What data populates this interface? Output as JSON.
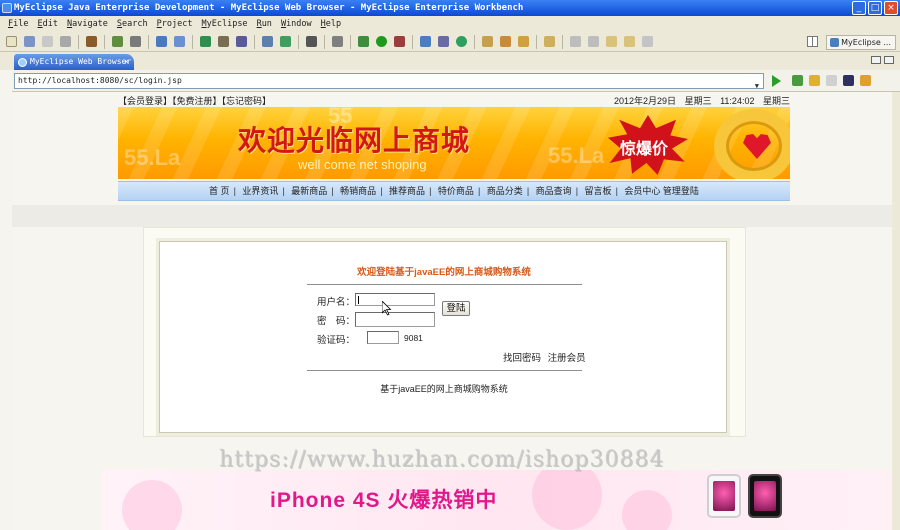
{
  "window": {
    "title": "MyEclipse Java Enterprise Development - MyEclipse Web Browser - MyEclipse Enterprise Workbench",
    "minimize": "_",
    "maximize": "□",
    "close": "×"
  },
  "menu": [
    "File",
    "Edit",
    "Navigate",
    "Search",
    "Project",
    "MyEclipse",
    "Run",
    "Window",
    "Help"
  ],
  "perspective": {
    "label": "MyEclipse ..."
  },
  "editor_tab": {
    "label": "MyEclipse Web Browser",
    "close": "×"
  },
  "address": {
    "url": "http://localhost:8080/sc/login.jsp",
    "dropdown": "▼"
  },
  "site": {
    "top_links": "【会员登录】【免费注册】【忘记密码】",
    "date": "2012年2月29日",
    "weekday": "星期三",
    "time": "11:24:02",
    "weekday2": "星期三",
    "banner_title": "欢迎光临网上商城",
    "banner_sub": "well come net shoping",
    "banner_badge": "惊爆价",
    "nav": [
      "首 页",
      "业界资讯",
      "最新商品",
      "畅销商品",
      "推荐商品",
      "特价商品",
      "商品分类",
      "商品查询",
      "留言板",
      "会员中心 管理登陆"
    ]
  },
  "login": {
    "title": "欢迎登陆基于javaEE的网上商城购物系统",
    "username_label": "用户名：",
    "password_label": "密　码：",
    "captcha_label": "验证码：",
    "captcha_value": "9081",
    "submit": "登陆",
    "forgot": "找回密码",
    "register": "注册会员",
    "footer": "基于javaEE的网上商城购物系统"
  },
  "overlay": {
    "watermark": "https://www.huzhan.com/ishop30884",
    "ad_text": "iPhone 4S 火爆热销中"
  },
  "colors": {
    "banner_title": "#d21717",
    "login_title": "#d55a1a",
    "ad_text": "#e0188a",
    "titlebar": "#0a4ad4"
  }
}
